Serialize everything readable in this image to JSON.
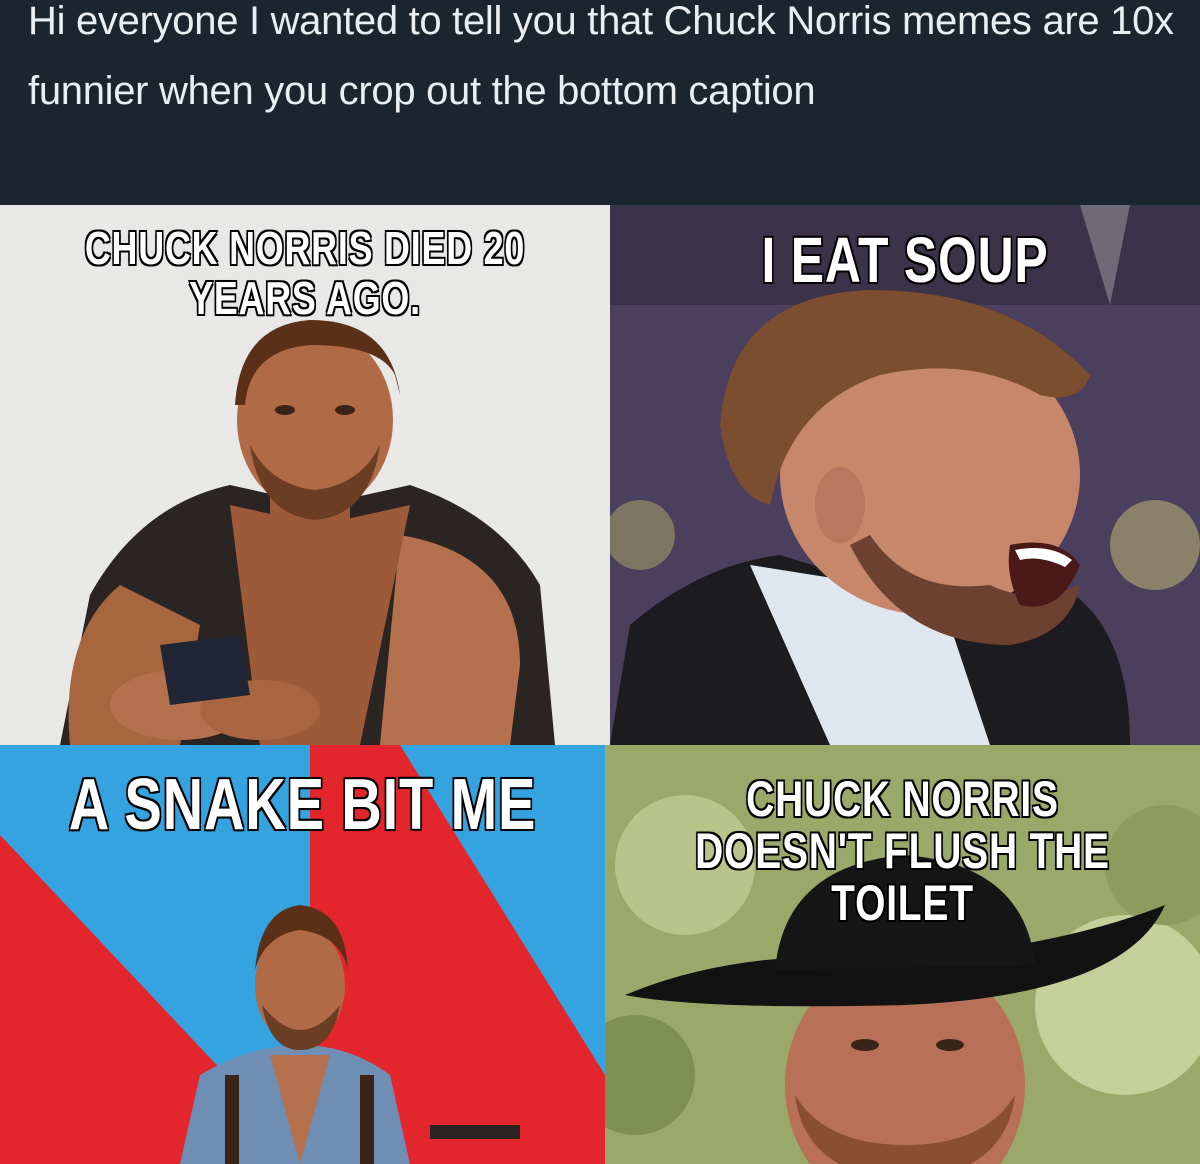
{
  "post": {
    "text": "Hi everyone I wanted to tell you that Chuck Norris memes are 10x funnier when you crop out the bottom caption"
  },
  "memes": [
    {
      "caption": "Chuck Norris died 20 years ago."
    },
    {
      "caption": "I eat soup"
    },
    {
      "caption": "A snake bit me"
    },
    {
      "caption": "Chuck Norris doesn't flush the toilet"
    }
  ],
  "colors": {
    "header_bg": "#1b2530",
    "header_text": "#e9eef2",
    "meme1_bg": "#e8e8e6",
    "meme2_bg": "#4a3f5c",
    "meme3_red": "#e3252c",
    "meme3_blue": "#35a3e0",
    "meme4_bg": "#9aa86a"
  }
}
